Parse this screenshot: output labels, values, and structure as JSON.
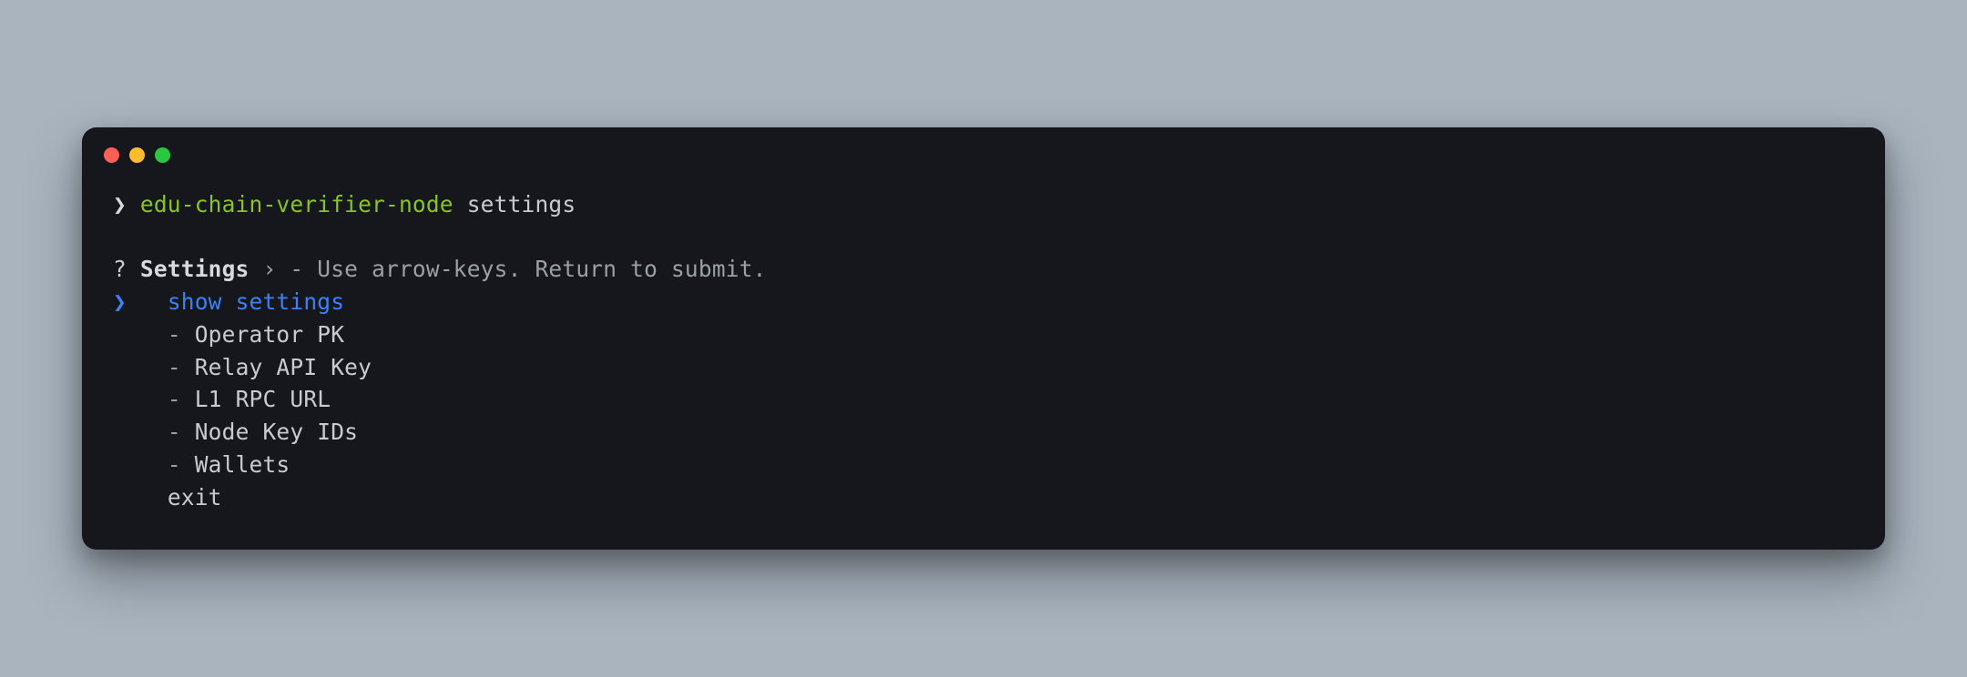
{
  "prompt": {
    "symbol": "❯",
    "binary": "edu-chain-verifier-node",
    "arg": "settings"
  },
  "questionLine": {
    "qmark": "?",
    "label": "Settings",
    "sep": "›",
    "hint": "- Use arrow-keys. Return to submit."
  },
  "menu": {
    "selectedIndex": 0,
    "chevron": "❯",
    "items": [
      {
        "prefix": "",
        "text": "show settings"
      },
      {
        "prefix": "- ",
        "text": "Operator PK"
      },
      {
        "prefix": "- ",
        "text": "Relay API Key"
      },
      {
        "prefix": "- ",
        "text": "L1 RPC URL"
      },
      {
        "prefix": "- ",
        "text": "Node Key IDs"
      },
      {
        "prefix": "- ",
        "text": "Wallets"
      },
      {
        "prefix": "",
        "text": "exit"
      }
    ]
  }
}
